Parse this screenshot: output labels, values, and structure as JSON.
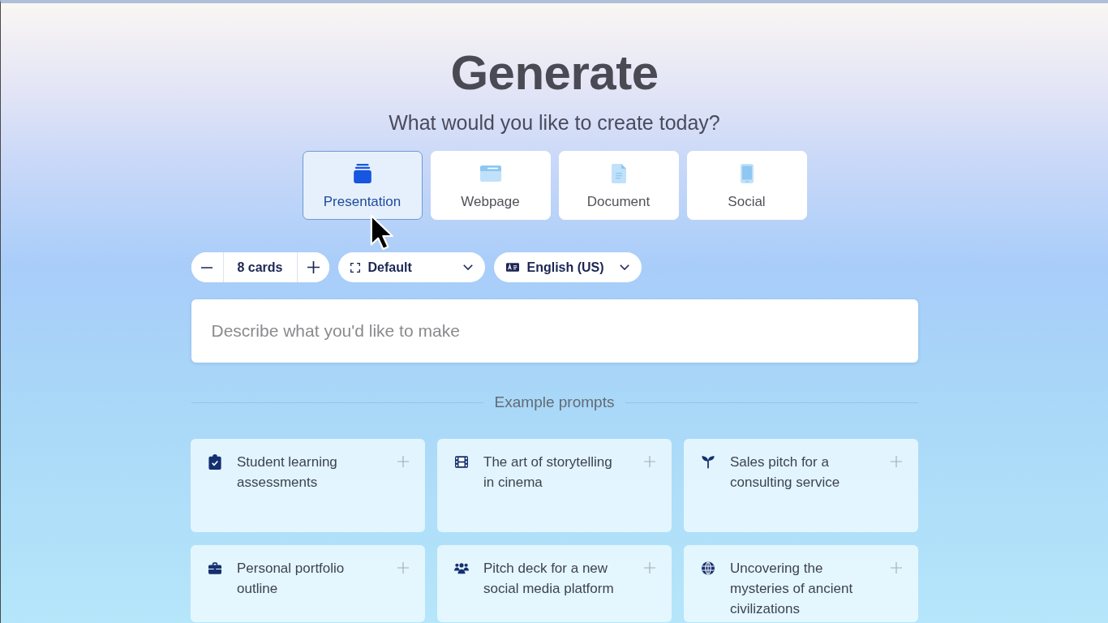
{
  "heading": "Generate",
  "subheading": "What would you like to create today?",
  "content_types": [
    {
      "kind": "presentation",
      "label": "Presentation",
      "selected": true
    },
    {
      "kind": "webpage",
      "label": "Webpage",
      "selected": false
    },
    {
      "kind": "document",
      "label": "Document",
      "selected": false
    },
    {
      "kind": "social",
      "label": "Social",
      "selected": false
    }
  ],
  "options": {
    "card_count": "8 cards",
    "theme": "Default",
    "language": "English (US)"
  },
  "prompt_field": {
    "placeholder": "Describe what you'd like to make"
  },
  "examples": {
    "title": "Example prompts",
    "prompts": [
      {
        "kind": "clipboard",
        "text": "Student learning assessments"
      },
      {
        "kind": "film",
        "text": "The art of storytelling in cinema"
      },
      {
        "kind": "sprout",
        "text": "Sales pitch for a consulting service"
      },
      {
        "kind": "briefcase",
        "text": "Personal portfolio outline"
      },
      {
        "kind": "people",
        "text": "Pitch deck for a new social media platform"
      },
      {
        "kind": "globe",
        "text": "Uncovering the mysteries of ancient civilizations"
      }
    ]
  }
}
